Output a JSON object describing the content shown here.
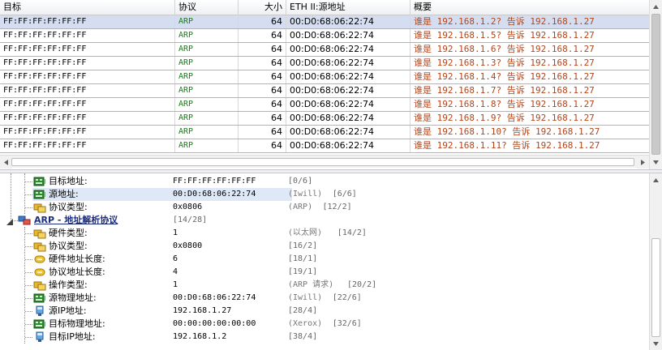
{
  "packet_list": {
    "columns": [
      "目标",
      "协议",
      "大小",
      "ETH II:源地址",
      "概要"
    ],
    "rows": [
      {
        "dst": "FF:FF:FF:FF:FF:FF",
        "protocol": "ARP",
        "size": "64",
        "src": "00:D0:68:06:22:74",
        "summary": "谁是 192.168.1.2? 告诉 192.168.1.27",
        "selected": true
      },
      {
        "dst": "FF:FF:FF:FF:FF:FF",
        "protocol": "ARP",
        "size": "64",
        "src": "00:D0:68:06:22:74",
        "summary": "谁是 192.168.1.5? 告诉 192.168.1.27"
      },
      {
        "dst": "FF:FF:FF:FF:FF:FF",
        "protocol": "ARP",
        "size": "64",
        "src": "00:D0:68:06:22:74",
        "summary": "谁是 192.168.1.6? 告诉 192.168.1.27"
      },
      {
        "dst": "FF:FF:FF:FF:FF:FF",
        "protocol": "ARP",
        "size": "64",
        "src": "00:D0:68:06:22:74",
        "summary": "谁是 192.168.1.3? 告诉 192.168.1.27"
      },
      {
        "dst": "FF:FF:FF:FF:FF:FF",
        "protocol": "ARP",
        "size": "64",
        "src": "00:D0:68:06:22:74",
        "summary": "谁是 192.168.1.4? 告诉 192.168.1.27"
      },
      {
        "dst": "FF:FF:FF:FF:FF:FF",
        "protocol": "ARP",
        "size": "64",
        "src": "00:D0:68:06:22:74",
        "summary": "谁是 192.168.1.7? 告诉 192.168.1.27"
      },
      {
        "dst": "FF:FF:FF:FF:FF:FF",
        "protocol": "ARP",
        "size": "64",
        "src": "00:D0:68:06:22:74",
        "summary": "谁是 192.168.1.8? 告诉 192.168.1.27"
      },
      {
        "dst": "FF:FF:FF:FF:FF:FF",
        "protocol": "ARP",
        "size": "64",
        "src": "00:D0:68:06:22:74",
        "summary": "谁是 192.168.1.9? 告诉 192.168.1.27"
      },
      {
        "dst": "FF:FF:FF:FF:FF:FF",
        "protocol": "ARP",
        "size": "64",
        "src": "00:D0:68:06:22:74",
        "summary": "谁是 192.168.1.10? 告诉 192.168.1.27"
      },
      {
        "dst": "FF:FF:FF:FF:FF:FF",
        "protocol": "ARP",
        "size": "64",
        "src": "00:D0:68:06:22:74",
        "summary": "谁是 192.168.1.11? 告诉 192.168.1.27"
      }
    ]
  },
  "detail_tree": {
    "eth_fields": [
      {
        "label": "目标地址:",
        "value": "FF:FF:FF:FF:FF:FF",
        "desc": "",
        "range": "[0/6]",
        "icon": "mac-address-icon"
      },
      {
        "label": "源地址:",
        "value": "00:D0:68:06:22:74",
        "desc": "(Iwill)",
        "range": "[6/6]",
        "icon": "mac-address-icon",
        "highlighted": true
      },
      {
        "label": "协议类型:",
        "value": "0x0806",
        "desc": "(ARP)",
        "range": "[12/2]",
        "icon": "field-icon"
      }
    ],
    "arp_section": {
      "label": "ARP - 地址解析协议",
      "range": "[14/28]",
      "icon": "protocol-icon"
    },
    "arp_fields": [
      {
        "label": "硬件类型:",
        "value": "1",
        "desc": "(以太网)",
        "range": "[14/2]",
        "icon": "field-icon"
      },
      {
        "label": "协议类型:",
        "value": "0x0800",
        "desc": "",
        "range": "[16/2]",
        "icon": "field-icon"
      },
      {
        "label": "硬件地址长度:",
        "value": "6",
        "desc": "",
        "range": "[18/1]",
        "icon": "length-icon"
      },
      {
        "label": "协议地址长度:",
        "value": "4",
        "desc": "",
        "range": "[19/1]",
        "icon": "length-icon"
      },
      {
        "label": "操作类型:",
        "value": "1",
        "desc": "(ARP 请求)",
        "range": "[20/2]",
        "icon": "field-icon"
      },
      {
        "label": "源物理地址:",
        "value": "00:D0:68:06:22:74",
        "desc": "(Iwill)",
        "range": "[22/6]",
        "icon": "mac-address-icon"
      },
      {
        "label": "源IP地址:",
        "value": "192.168.1.27",
        "desc": "",
        "range": "[28/4]",
        "icon": "ip-address-icon"
      },
      {
        "label": "目标物理地址:",
        "value": "00:00:00:00:00:00",
        "desc": "(Xerox)",
        "range": "[32/6]",
        "icon": "mac-address-icon"
      },
      {
        "label": "目标IP地址:",
        "value": "192.168.1.2",
        "desc": "",
        "range": "[38/4]",
        "icon": "ip-address-icon"
      }
    ]
  },
  "colors": {
    "protocol_text": "#1a7d1a",
    "summary_text": "#b3441a",
    "selected_row": "#d5def0",
    "section_header": "#1c2d7a"
  }
}
